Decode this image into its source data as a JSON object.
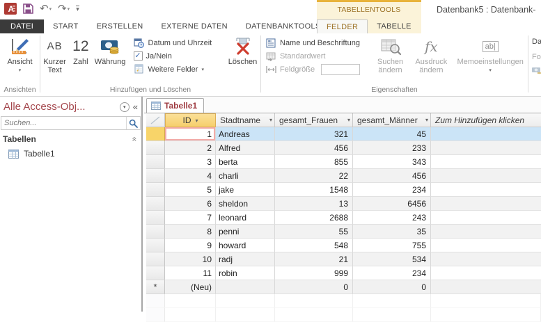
{
  "colors": {
    "accent_red": "#A4373A",
    "contextual_gold_bar": "#E8B33B",
    "contextual_bg": "#FBF3D9",
    "contextual_text": "#9C7226",
    "selected_row": "#CBE4F7",
    "current_cell_border": "#F2ABA8",
    "selected_column_header": "#F8D66E",
    "file_tab_bg": "#3A3A3A"
  },
  "titlebar": {
    "context_label": "TABELLENTOOLS",
    "app_title": "Datenbank5 : Datenbank-",
    "icons": [
      "access-logo",
      "save-icon",
      "undo-icon",
      "redo-icon",
      "customize-quick-access-icon"
    ]
  },
  "tabs": {
    "file": "DATEI",
    "main": [
      "START",
      "ERSTELLEN",
      "EXTERNE DATEN",
      "DATENBANKTOOLS"
    ],
    "contextual": {
      "felder": "FELDER",
      "tabelle": "TABELLE"
    }
  },
  "ribbon": {
    "ansichten": {
      "label": "Ansichten",
      "ansicht": "Ansicht"
    },
    "hinzufuegen_loeschen": {
      "label": "Hinzufügen und Löschen",
      "kurzer_text_glyph": "AB",
      "kurzer_text": "Kurzer Text",
      "zahl_glyph": "12",
      "zahl": "Zahl",
      "waehrung": "Währung",
      "datum_uhrzeit": "Datum und Uhrzeit",
      "ja_nein": "Ja/Nein",
      "weitere_felder": "Weitere Felder",
      "loeschen": "Löschen"
    },
    "eigenschaften": {
      "label": "Eigenschaften",
      "name_beschriftung": "Name und Beschriftung",
      "standardwert": "Standardwert",
      "feldgroesse": "Feldgröße",
      "suchen_aendern": "Suchen ändern",
      "ausdruck_aendern": "Ausdruck ändern",
      "memoeinstellungen": "Memoeinstellungen"
    },
    "formatierung": {
      "datentyp": "Datentyp:",
      "format": "Format:"
    }
  },
  "navpane": {
    "title": "Alle Access-Obj...",
    "search_placeholder": "Suchen...",
    "group_tabellen": "Tabellen",
    "items": [
      {
        "icon": "table-icon",
        "label": "Tabelle1"
      }
    ]
  },
  "document": {
    "tab_label": "Tabelle1"
  },
  "datasheet": {
    "headers": {
      "id": "ID",
      "stadtname": "Stadtname",
      "gesamt_frauen": "gesamt_Frauen",
      "gesamt_maenner": "gesamt_Männer",
      "add_column": "Zum Hinzufügen klicken"
    },
    "new_row_marker": "*",
    "rows": [
      {
        "id": "1",
        "stadtname": "Andreas",
        "gesamt_frauen": "321",
        "gesamt_maenner": "45",
        "selected": true
      },
      {
        "id": "2",
        "stadtname": "Alfred",
        "gesamt_frauen": "456",
        "gesamt_maenner": "233"
      },
      {
        "id": "3",
        "stadtname": "berta",
        "gesamt_frauen": "855",
        "gesamt_maenner": "343"
      },
      {
        "id": "4",
        "stadtname": "charli",
        "gesamt_frauen": "22",
        "gesamt_maenner": "456"
      },
      {
        "id": "5",
        "stadtname": "jake",
        "gesamt_frauen": "1548",
        "gesamt_maenner": "234"
      },
      {
        "id": "6",
        "stadtname": "sheldon",
        "gesamt_frauen": "13",
        "gesamt_maenner": "6456"
      },
      {
        "id": "7",
        "stadtname": "leonard",
        "gesamt_frauen": "2688",
        "gesamt_maenner": "243"
      },
      {
        "id": "8",
        "stadtname": "penni",
        "gesamt_frauen": "55",
        "gesamt_maenner": "35"
      },
      {
        "id": "9",
        "stadtname": "howard",
        "gesamt_frauen": "548",
        "gesamt_maenner": "755"
      },
      {
        "id": "10",
        "stadtname": "radj",
        "gesamt_frauen": "21",
        "gesamt_maenner": "534"
      },
      {
        "id": "11",
        "stadtname": "robin",
        "gesamt_frauen": "999",
        "gesamt_maenner": "234"
      },
      {
        "id": "(Neu)",
        "stadtname": "",
        "gesamt_frauen": "0",
        "gesamt_maenner": "0",
        "new": true
      }
    ]
  }
}
